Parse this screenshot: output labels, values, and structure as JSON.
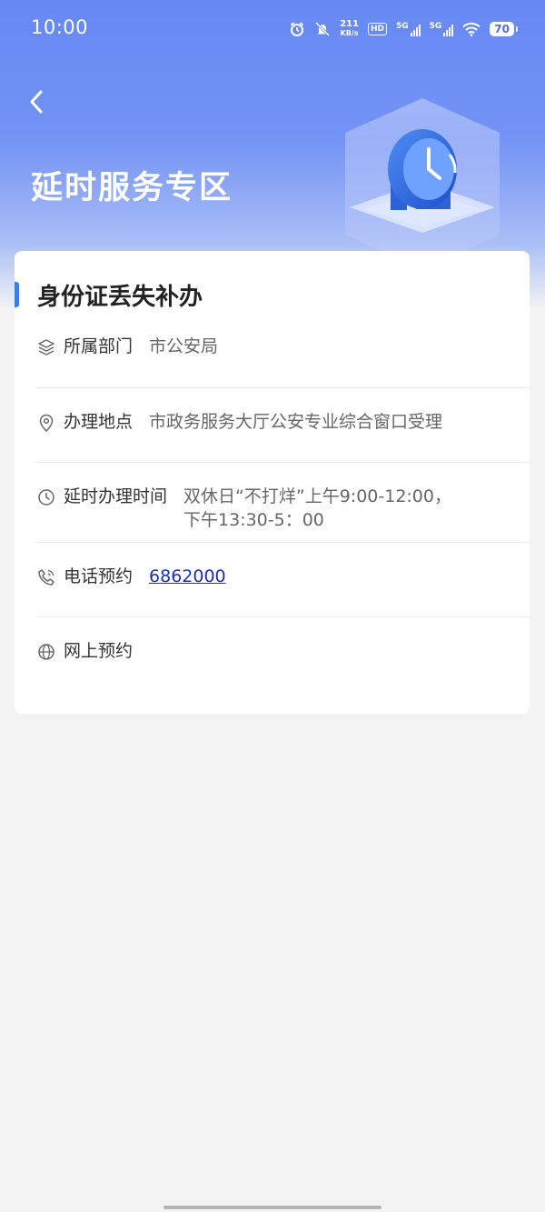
{
  "status_bar": {
    "time": "10:00",
    "net_speed_value": "211",
    "net_speed_unit": "KB/s",
    "hd_label": "HD",
    "signal1_label": "5G",
    "signal2_label": "5G",
    "battery": "70"
  },
  "header": {
    "title": "延时服务专区"
  },
  "card": {
    "title": "身份证丢失补办",
    "rows": [
      {
        "label": "所属部门",
        "value": "市公安局"
      },
      {
        "label": "办理地点",
        "value": "市政务服务大厅公安专业综合窗口受理"
      },
      {
        "label": "延时办理时间",
        "value_line1": "双休日“不打烊”上午9:00-12:00，",
        "value_line2": "下午13:30-5：00"
      },
      {
        "label": "电话预约",
        "value": "6862000"
      },
      {
        "label": "网上预约",
        "value": ""
      }
    ]
  },
  "colors": {
    "accent": "#3f7ce6",
    "link": "#1a2dcf",
    "header_blue": "#6688f3"
  }
}
